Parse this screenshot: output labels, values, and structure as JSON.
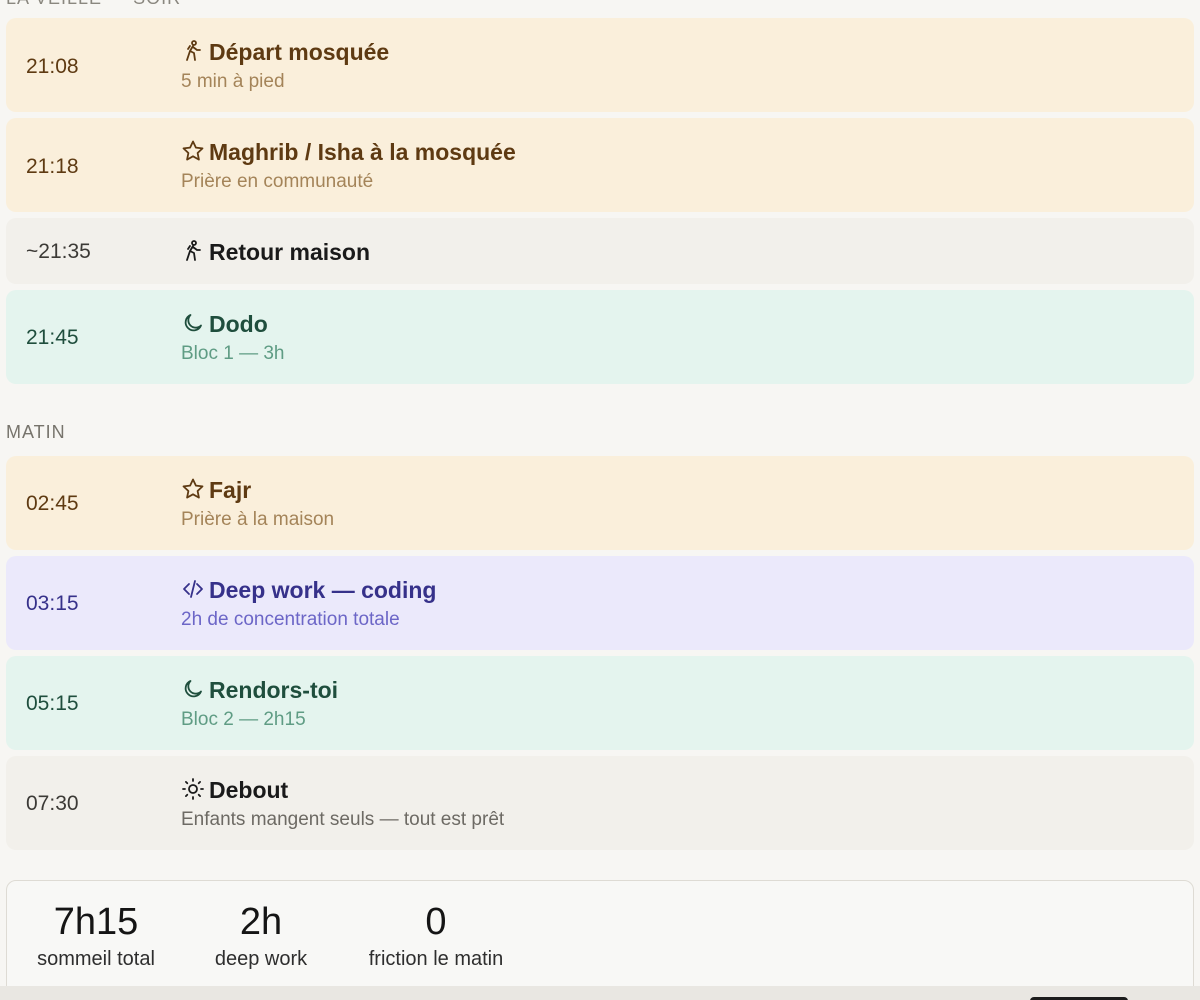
{
  "sections": {
    "evening_label": "LA VEILLE — SOIR",
    "morning_label": "MATIN"
  },
  "evening": [
    {
      "time": "21:08",
      "icon": "walk-icon",
      "title": "Départ mosquée",
      "sub": "5 min à pied",
      "kind": "prayer"
    },
    {
      "time": "21:18",
      "icon": "star-icon",
      "title": "Maghrib / Isha à la mosquée",
      "sub": "Prière en communauté",
      "kind": "prayer"
    },
    {
      "time": "~21:35",
      "icon": "walk-icon",
      "title": "Retour maison",
      "sub": "",
      "kind": "neutral"
    },
    {
      "time": "21:45",
      "icon": "moon-icon",
      "title": "Dodo",
      "sub": "Bloc 1 — 3h",
      "kind": "sleep"
    }
  ],
  "morning": [
    {
      "time": "02:45",
      "icon": "star-icon",
      "title": "Fajr",
      "sub": "Prière à la maison",
      "kind": "prayer"
    },
    {
      "time": "03:15",
      "icon": "code-icon",
      "title": "Deep work — coding",
      "sub": "2h de concentration totale",
      "kind": "work"
    },
    {
      "time": "05:15",
      "icon": "moon-icon",
      "title": "Rendors-toi",
      "sub": "Bloc 2 — 2h15",
      "kind": "sleep"
    },
    {
      "time": "07:30",
      "icon": "sun-icon",
      "title": "Debout",
      "sub": "Enfants mangent seuls — tout est prêt",
      "kind": "neutral"
    }
  ],
  "summary": {
    "sleep_value": "7h15",
    "sleep_label": "sommeil total",
    "work_value": "2h",
    "work_label": "deep work",
    "friction_value": "0",
    "friction_label": "friction le matin"
  },
  "colors": {
    "prayer_bg": "#faefdb",
    "neutral_bg": "#f2f0eb",
    "sleep_bg": "#e4f4ee",
    "work_bg": "#ebe9fb"
  }
}
